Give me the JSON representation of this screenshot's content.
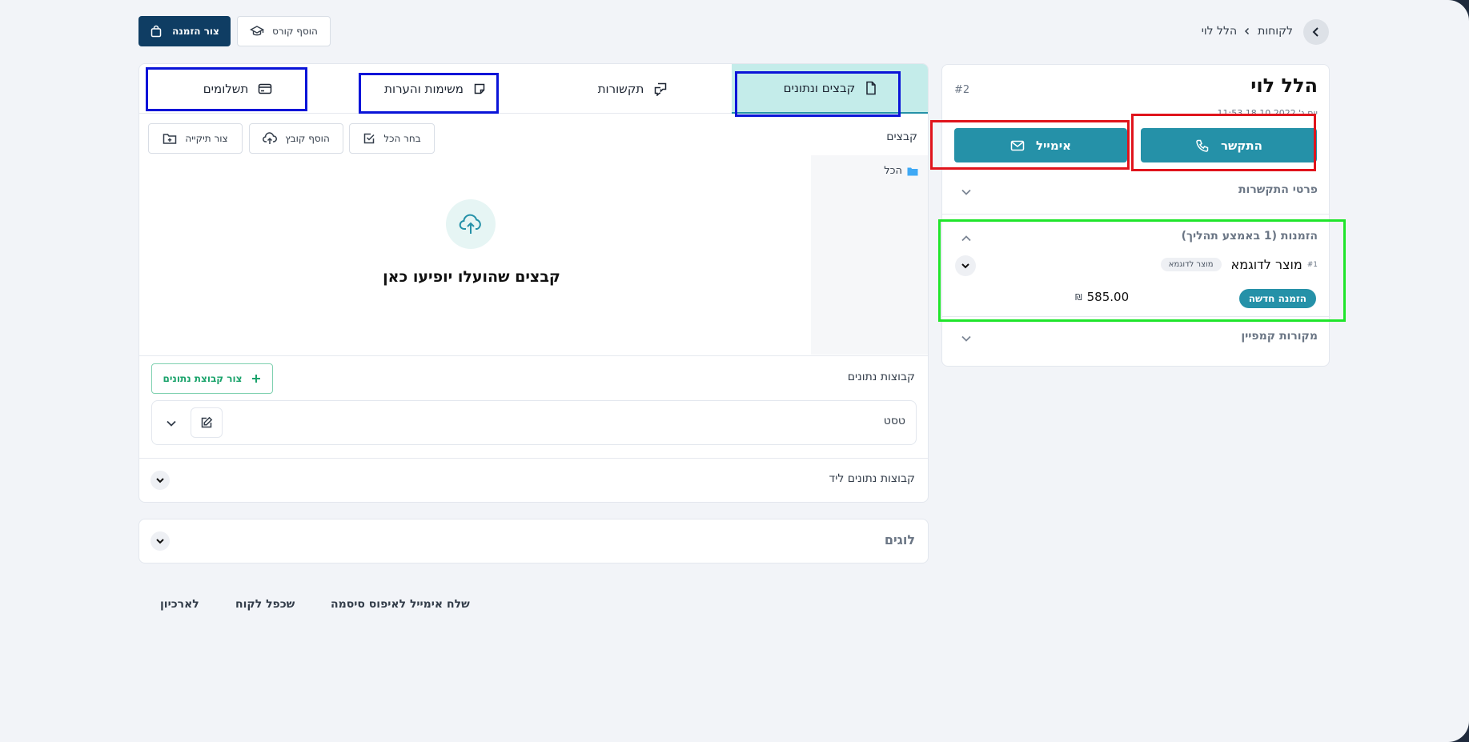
{
  "header": {
    "breadcrumb_parent": "לקוחות",
    "breadcrumb_current": "הלל לוי",
    "create_order_label": "צור הזמנה",
    "add_course_label": "הוסף קורס"
  },
  "customer": {
    "name": "הלל לוי",
    "id": "#2",
    "date_label": "יום ג' 18.10.2022 11:53",
    "call_label": "התקשר",
    "email_label": "אימייל",
    "contact_details_label": "פרטי התקשרות",
    "orders_label": "הזמנות (1 באמצע תהליך)",
    "order_item_number": "#1",
    "order_item_name": "מוצר לדוגמא",
    "order_item_badge": "מוצר לדוגמא",
    "order_status": "הזמנה חדשה",
    "order_price": "585.00",
    "currency": "₪",
    "campaign_sources_label": "מקורות קמפיין"
  },
  "tabs": [
    {
      "label": "קבצים ונתונים"
    },
    {
      "label": "תקשורות"
    },
    {
      "label": "משימות והערות"
    },
    {
      "label": "תשלומים"
    }
  ],
  "files": {
    "section_label": "קבצים",
    "select_all_label": "בחר הכל",
    "add_file_label": "הוסף קובץ",
    "create_folder_label": "צור תיקייה",
    "folder_all_label": "הכל",
    "empty_text": "קבצים שהועלו יופיעו כאן"
  },
  "datasets": {
    "section_label": "קבוצות נתונים",
    "create_label": "צור קבוצת נתונים",
    "item_name": "טסט",
    "lead_label": "קבוצות נתונים ליד"
  },
  "logs": {
    "label": "לוגים"
  },
  "footer": {
    "reset_password_label": "שלח אימייל לאיפוס סיסמה",
    "duplicate_label": "שכפל לקוח",
    "archive_label": "לארכיון"
  },
  "colors": {
    "teal": "#2591a8",
    "navy": "#0f3d63",
    "active_tab": "#c4ecea",
    "green": "#1aa36b"
  }
}
